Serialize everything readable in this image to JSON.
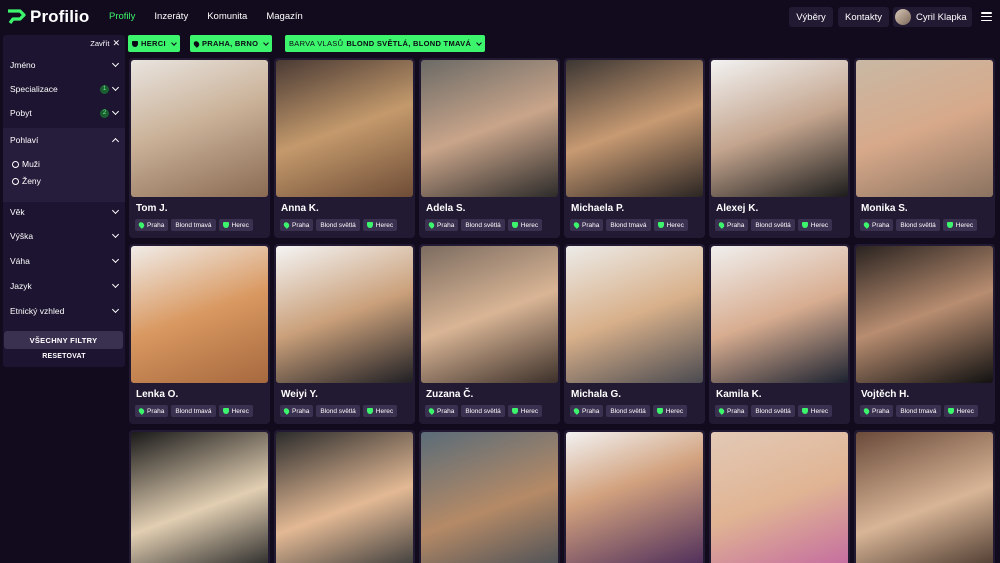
{
  "header": {
    "logo_text": "Profilio",
    "nav": [
      {
        "label": "Profily",
        "active": true
      },
      {
        "label": "Inzeráty",
        "active": false
      },
      {
        "label": "Komunita",
        "active": false
      },
      {
        "label": "Magazín",
        "active": false
      }
    ],
    "vybery_label": "Výběry",
    "kontakty_label": "Kontakty",
    "user_name": "Cyril Klapka"
  },
  "sidebar": {
    "close_label": "Zavřít",
    "filters": [
      {
        "label": "Jméno"
      },
      {
        "label": "Specializace",
        "badge": "1"
      },
      {
        "label": "Pobyt",
        "badge": "2"
      },
      {
        "label": "Pohlaví",
        "expanded": true
      },
      {
        "label": "Věk"
      },
      {
        "label": "Výška"
      },
      {
        "label": "Váha"
      },
      {
        "label": "Jazyk"
      },
      {
        "label": "Etnický vzhled"
      }
    ],
    "gender_options": [
      "Muži",
      "Ženy"
    ],
    "all_filters_label": "VŠECHNY FILTRY",
    "reset_label": "RESETOVAT"
  },
  "chips": [
    {
      "label": "HERCI"
    },
    {
      "label": "PRAHA, BRNO"
    },
    {
      "prefix": "BARVA VLASŮ",
      "label": "BLOND SVĚTLÁ, BLOND TMAVÁ"
    }
  ],
  "profiles": [
    {
      "name": "Tom J.",
      "city": "Praha",
      "hair": "Blond tmavá",
      "role": "Herec"
    },
    {
      "name": "Anna K.",
      "city": "Praha",
      "hair": "Blond světlá",
      "role": "Herec"
    },
    {
      "name": "Adela S.",
      "city": "Praha",
      "hair": "Blond světlá",
      "role": "Herec"
    },
    {
      "name": "Michaela P.",
      "city": "Praha",
      "hair": "Blond tmavá",
      "role": "Herec"
    },
    {
      "name": "Alexej K.",
      "city": "Praha",
      "hair": "Blond světlá",
      "role": "Herec"
    },
    {
      "name": "Monika S.",
      "city": "Praha",
      "hair": "Blond světlá",
      "role": "Herec"
    },
    {
      "name": "Lenka O.",
      "city": "Praha",
      "hair": "Blond tmavá",
      "role": "Herec"
    },
    {
      "name": "Weiyi Y.",
      "city": "Praha",
      "hair": "Blond světlá",
      "role": "Herec"
    },
    {
      "name": "Zuzana Č.",
      "city": "Praha",
      "hair": "Blond světlá",
      "role": "Herec"
    },
    {
      "name": "Michala G.",
      "city": "Praha",
      "hair": "Blond světlá",
      "role": "Herec"
    },
    {
      "name": "Kamila K.",
      "city": "Praha",
      "hair": "Blond světlá",
      "role": "Herec"
    },
    {
      "name": "Vojtěch H.",
      "city": "Praha",
      "hair": "Blond tmavá",
      "role": "Herec"
    },
    {
      "name": "",
      "city": "",
      "hair": "",
      "role": ""
    },
    {
      "name": "",
      "city": "",
      "hair": "",
      "role": ""
    },
    {
      "name": "",
      "city": "",
      "hair": "",
      "role": ""
    },
    {
      "name": "",
      "city": "",
      "hair": "",
      "role": ""
    },
    {
      "name": "",
      "city": "",
      "hair": "",
      "role": ""
    },
    {
      "name": "",
      "city": "",
      "hair": "",
      "role": ""
    }
  ],
  "colors": {
    "accent": "#3cf56d",
    "background": "#120b1e",
    "card": "#221933"
  }
}
